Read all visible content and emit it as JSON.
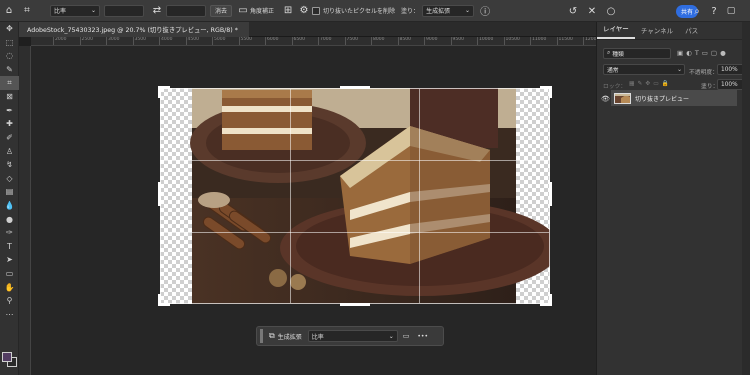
{
  "options_bar": {
    "ratio_label": "比率",
    "clear_label": "消去",
    "straighten_label": "角度補正",
    "delete_pixels_label": "切り抜いたピクセルを削除",
    "fill_label": "塗り：",
    "fill_value": "生成拡張",
    "share_label": "共有"
  },
  "document": {
    "tab_title": "AdobeStock_75430323.jpeg @ 20.7% (切り抜きプレビュー, RGB/8) *"
  },
  "ruler": {
    "ticks": [
      "2000",
      "2500",
      "3000",
      "3500",
      "4000",
      "4500",
      "5000",
      "5500",
      "6000",
      "6500",
      "7000",
      "7500",
      "8000",
      "8500",
      "9000",
      "9500",
      "10000",
      "10500",
      "11000",
      "11500",
      "12000"
    ]
  },
  "context_bar": {
    "generative_expand_label": "生成拡張",
    "ratio_label": "比率",
    "more_label": "•••"
  },
  "layers_panel": {
    "tabs": [
      "レイヤー",
      "チャンネル",
      "パス"
    ],
    "search_placeholder": "種類",
    "blend_mode": "通常",
    "opacity_label": "不透明度：",
    "opacity_value": "100%",
    "lock_label": "ロック：",
    "fill_label": "塗り：",
    "fill_value": "100%",
    "layer_name": "切り抜きプレビュー"
  },
  "colors": {
    "accent": "#2f6de0",
    "foreground": "#533d63"
  }
}
